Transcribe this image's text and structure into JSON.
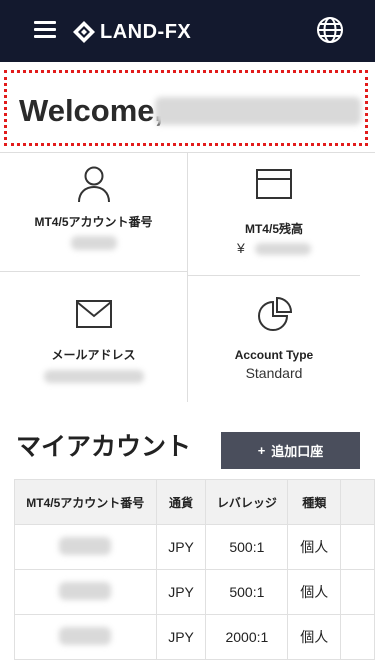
{
  "header": {
    "logo_text": "LAND-FX",
    "menu_icon": "hamburger-menu-icon",
    "language_icon": "globe-icon",
    "background": "#13192e"
  },
  "welcome": {
    "greeting": "Welcome,"
  },
  "info_tiles": [
    {
      "icon": "user-icon",
      "label": "MT4/5アカウント番号",
      "value": ""
    },
    {
      "icon": "card-icon",
      "label": "MT4/5残高",
      "value": "¥"
    },
    {
      "icon": "mail-icon",
      "label": "メールアドレス",
      "value": ""
    },
    {
      "icon": "pie-chart-icon",
      "label": "Account Type",
      "value": "Standard"
    }
  ],
  "my_account": {
    "title": "マイアカウント",
    "add_button_label": "追加口座",
    "add_button_icon": "plus-icon",
    "table": {
      "columns": [
        "MT4/5アカウント番号",
        "通貨",
        "レバレッジ",
        "種類"
      ],
      "rows": [
        {
          "account": "",
          "currency": "JPY",
          "leverage": "500:1",
          "type": "個人"
        },
        {
          "account": "",
          "currency": "JPY",
          "leverage": "500:1",
          "type": "個人"
        },
        {
          "account": "",
          "currency": "JPY",
          "leverage": "2000:1",
          "type": "個人"
        }
      ]
    }
  },
  "colors": {
    "header_bg": "#13192e",
    "highlight_border": "#e21b1b",
    "button_bg": "#4a4e5c"
  }
}
